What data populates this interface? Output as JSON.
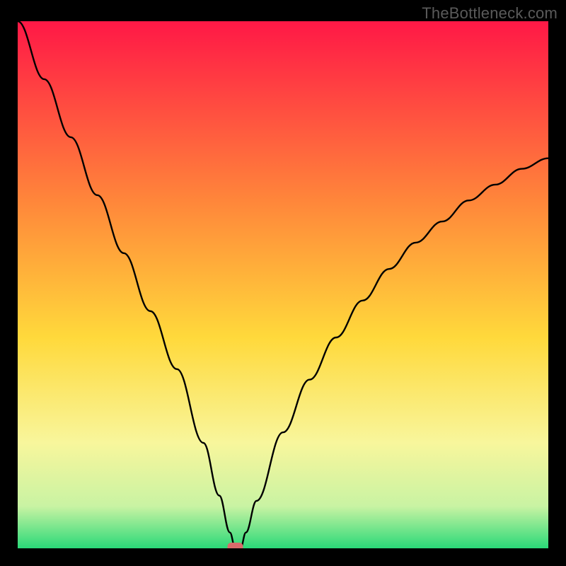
{
  "watermark": "TheBottleneck.com",
  "chart_data": {
    "type": "line",
    "title": "",
    "xlabel": "",
    "ylabel": "",
    "xlim": [
      0,
      100
    ],
    "ylim": [
      0,
      100
    ],
    "grid": false,
    "colors": {
      "gradient_top": "#ff1846",
      "gradient_upper_mid": "#ff893a",
      "gradient_mid": "#ffd93b",
      "gradient_lower_mid": "#f8f69c",
      "gradient_near_bottom": "#c9f3a3",
      "gradient_bottom": "#2ad978",
      "curve": "#000000",
      "marker": "#d96b6b",
      "frame": "#000000"
    },
    "background_gradient_stops": [
      {
        "offset": 0,
        "value": 100,
        "color": "#ff1846"
      },
      {
        "offset": 35,
        "value": 65,
        "color": "#ff893a"
      },
      {
        "offset": 60,
        "value": 40,
        "color": "#ffd93b"
      },
      {
        "offset": 80,
        "value": 20,
        "color": "#f8f69c"
      },
      {
        "offset": 92,
        "value": 8,
        "color": "#c9f3a3"
      },
      {
        "offset": 100,
        "value": 0,
        "color": "#2ad978"
      }
    ],
    "series": [
      {
        "name": "bottleneck-curve",
        "type": "line",
        "x": [
          0,
          5,
          10,
          15,
          20,
          25,
          30,
          35,
          38,
          40,
          41,
          42,
          43,
          45,
          50,
          55,
          60,
          65,
          70,
          75,
          80,
          85,
          90,
          95,
          100
        ],
        "values": [
          100,
          89,
          78,
          67,
          56,
          45,
          34,
          20,
          10,
          3,
          0,
          0,
          3,
          9,
          22,
          32,
          40,
          47,
          53,
          58,
          62,
          66,
          69,
          72,
          74
        ]
      }
    ],
    "marker": {
      "x": 41,
      "y": 0,
      "name": "minimum-marker"
    }
  }
}
